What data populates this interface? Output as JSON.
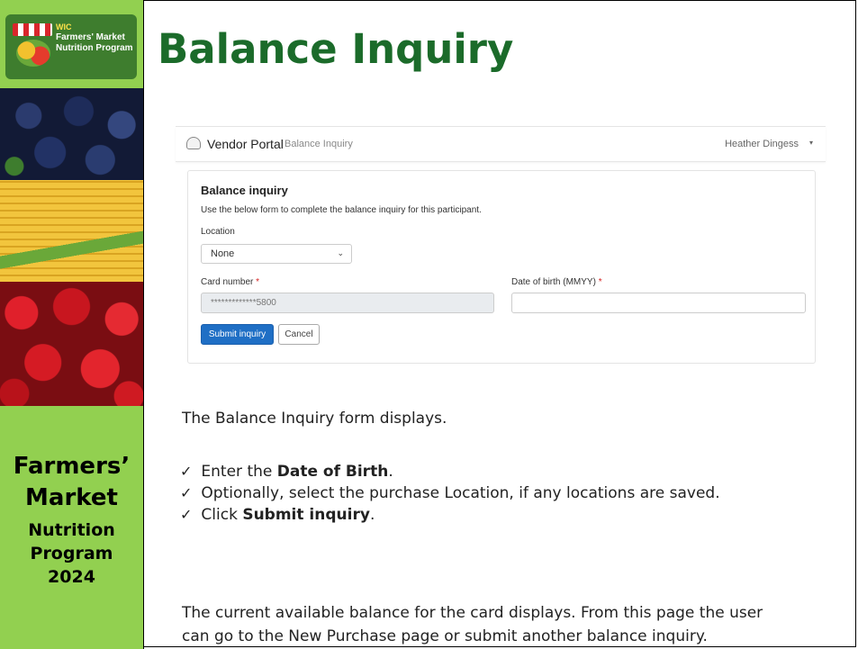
{
  "sidebar": {
    "logo": {
      "badge": "WIC",
      "line1": "Farmers' Market",
      "line2": "Nutrition Program"
    },
    "title_line1": "Farmers’",
    "title_line2": "Market",
    "title_line3": "Nutrition",
    "title_line4": "Program",
    "title_line5": "2024"
  },
  "heading": "Balance Inquiry",
  "screenshot": {
    "nav": {
      "brand": "Vendor Portal",
      "breadcrumb": "Balance Inquiry",
      "user": "Heather Dingess",
      "caret": "▾"
    },
    "form": {
      "title": "Balance inquiry",
      "description": "Use the below form to complete the balance inquiry for this participant.",
      "location_label": "Location",
      "location_value": "None",
      "card_number_label": "Card number",
      "card_number_value": "*************5800",
      "dob_label": "Date of birth (MMYY)",
      "dob_value": "",
      "required_mark": "*",
      "submit_label": "Submit inquiry",
      "cancel_label": "Cancel"
    }
  },
  "body": {
    "intro": "The Balance Inquiry form displays.",
    "steps": [
      {
        "pre": "Enter the ",
        "bold": "Date of Birth",
        "post": "."
      },
      {
        "pre": "Optionally, select the purchase Location, if any locations are saved.",
        "bold": "",
        "post": ""
      },
      {
        "pre": "Click ",
        "bold": "Submit inquiry",
        "post": "."
      }
    ],
    "check_glyph": "✓",
    "closing_line1": "The current available balance for the card displays. From this page the user",
    "closing_line2": "can go to the New Purchase page or submit another balance inquiry."
  },
  "colors": {
    "sidebar_bg": "#92d050",
    "heading": "#1b6b2a",
    "primary_button": "#1f6fc5"
  }
}
